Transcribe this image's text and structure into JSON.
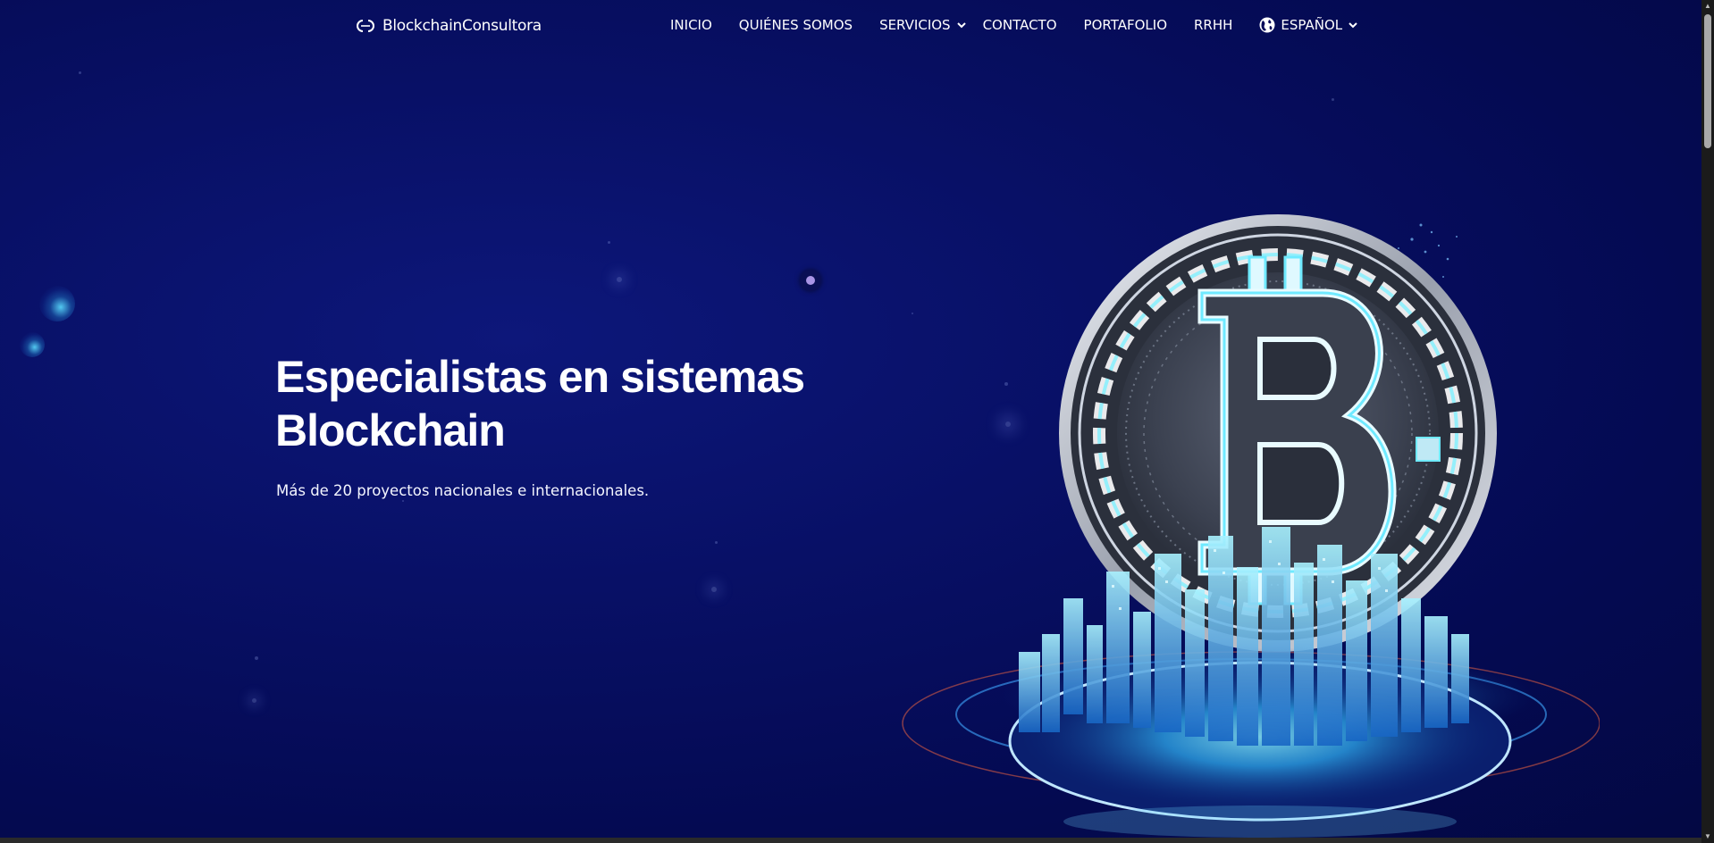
{
  "brand": {
    "name": "BlockchainConsultora"
  },
  "nav": {
    "items": [
      {
        "label": "INICIO",
        "icon": null,
        "dropdown": false
      },
      {
        "label": "QUIÉNES SOMOS",
        "icon": null,
        "dropdown": false
      },
      {
        "label": "SERVICIOS",
        "icon": null,
        "dropdown": true
      },
      {
        "label": "CONTACTO",
        "icon": null,
        "dropdown": false
      },
      {
        "label": "PORTAFOLIO",
        "icon": null,
        "dropdown": false
      },
      {
        "label": "RRHH",
        "icon": null,
        "dropdown": false
      }
    ],
    "language": {
      "label": "ESPAÑOL",
      "icon": "globe-icon",
      "dropdown": true
    }
  },
  "hero": {
    "title_line1": "Especialistas en sistemas",
    "title_line2": "Blockchain",
    "subtitle": "Más de 20 proyectos nacionales e internacionales."
  },
  "colors": {
    "background": "#050a5a",
    "text": "#ffffff",
    "accent_cyan": "#5fe0ff",
    "cursor_dot": "#a994e6"
  },
  "icons": [
    "logo-mark-icon",
    "chevron-down-icon",
    "globe-icon",
    "bitcoin-coin-illustration"
  ]
}
